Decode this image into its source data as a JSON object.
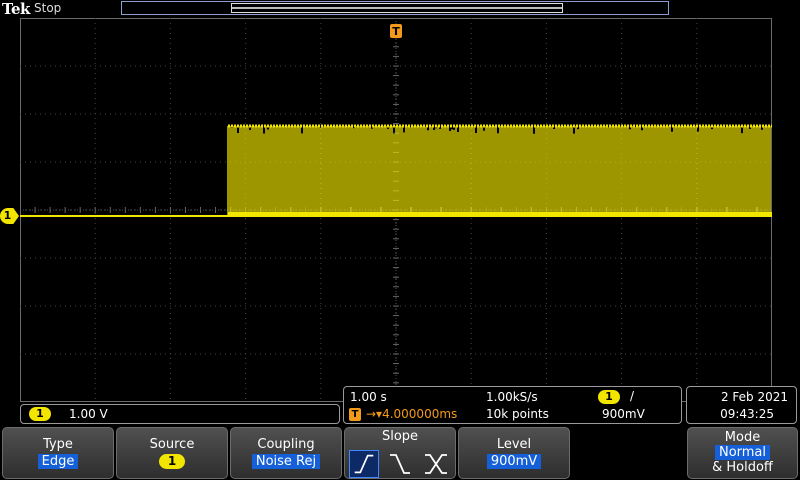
{
  "header": {
    "brand": "Tek",
    "run_state": "Stop",
    "trigger_marker_label": "T"
  },
  "channel": {
    "ground_marker_label": "1",
    "badge_label": "1",
    "scale": "1.00 V",
    "trace_color": "#f2e600"
  },
  "timebase": {
    "horizontal_scale": "1.00 s",
    "sample_rate": "1.00kS/s",
    "record_length": "10k points",
    "trigger_position_icon": "T",
    "trigger_delay": "4.000000ms"
  },
  "trigger_readout": {
    "source_badge": "1",
    "slope_symbol": "/",
    "level": "900mV"
  },
  "datetime": {
    "date": "2 Feb  2021",
    "time": "09:43:25"
  },
  "softkeys": {
    "type": {
      "label": "Type",
      "value": "Edge"
    },
    "source": {
      "label": "Source",
      "value": "1"
    },
    "coupling": {
      "label": "Coupling",
      "value": "Noise Rej"
    },
    "slope": {
      "label": "Slope",
      "options": [
        "rising-edge-icon",
        "falling-edge-icon",
        "either-edge-icon"
      ],
      "selected": "rising-edge-icon"
    },
    "level": {
      "label": "Level",
      "value": "900mV"
    },
    "mode": {
      "label": "Mode",
      "value": "Normal",
      "sub": "& Holdoff"
    }
  },
  "colors": {
    "channel1": "#f2e600",
    "trigger": "#f39a1a",
    "selected_value": "#1560d8"
  }
}
